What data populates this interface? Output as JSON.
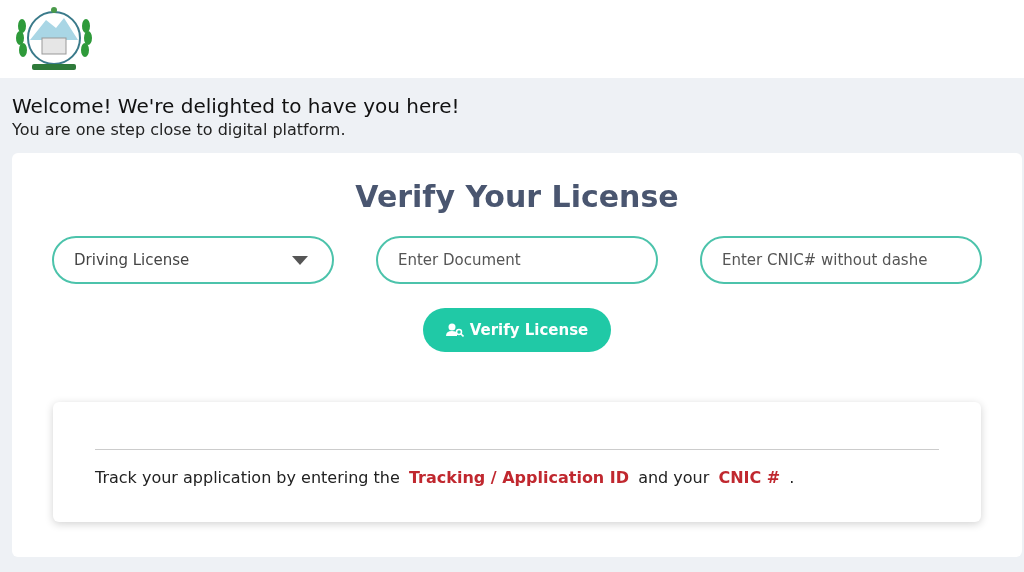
{
  "welcome": {
    "heading": "Welcome! We're delighted to have you here!",
    "subheading": "You are one step close to digital platform."
  },
  "verify": {
    "title": "Verify Your License",
    "document_type": {
      "value": "Driving License"
    },
    "document_field": {
      "placeholder": "Enter Document"
    },
    "cnic_field": {
      "placeholder": "Enter CNIC# without dashe"
    },
    "button": "Verify License"
  },
  "tracking_note": "Track your application by entering the **Tracking / Application ID** and your **CNIC #** ."
}
